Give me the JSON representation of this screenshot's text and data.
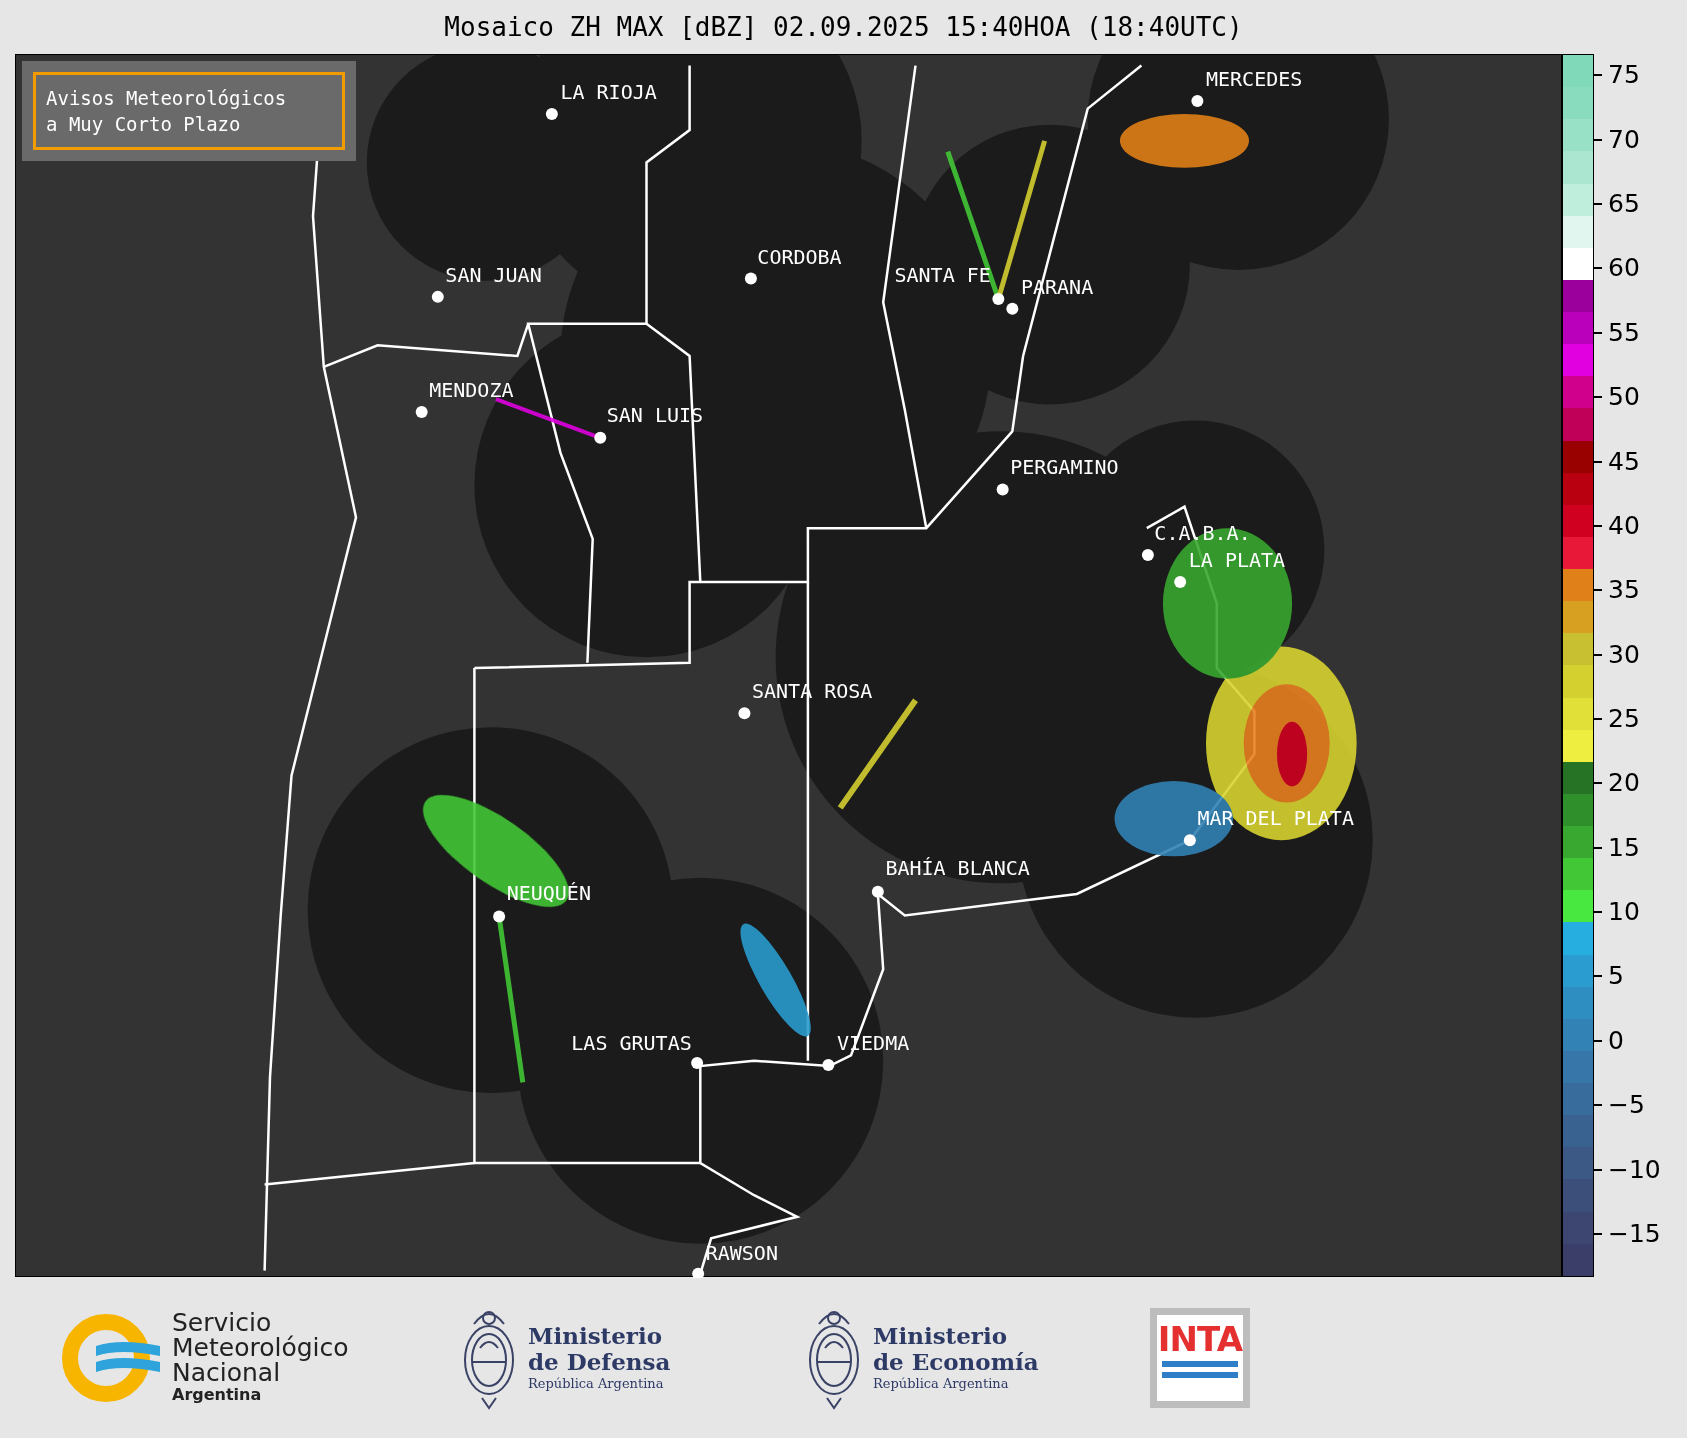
{
  "title": "Mosaico ZH MAX [dBZ] 02.09.2025 15:40HOA (18:40UTC)",
  "notice_box": {
    "lines": [
      "Avisos Meteorológicos",
      "a Muy Corto Plazo"
    ]
  },
  "cities": [
    {
      "name": "LA RIOJA"
    },
    {
      "name": "CORDOBA"
    },
    {
      "name": "SAN JUAN"
    },
    {
      "name": "SANTA FE"
    },
    {
      "name": "PARANA"
    },
    {
      "name": "MERCEDES"
    },
    {
      "name": "MENDOZA"
    },
    {
      "name": "SAN LUIS"
    },
    {
      "name": "PERGAMINO"
    },
    {
      "name": "C.A.B.A."
    },
    {
      "name": "LA PLATA"
    },
    {
      "name": "SANTA ROSA"
    },
    {
      "name": "MAR DEL PLATA"
    },
    {
      "name": "BAHÍA BLANCA"
    },
    {
      "name": "NEUQUÉN"
    },
    {
      "name": "LAS GRUTAS"
    },
    {
      "name": "VIEDMA"
    },
    {
      "name": "RAWSON"
    }
  ],
  "colorbar": {
    "ticks": [
      "75",
      "70",
      "65",
      "60",
      "55",
      "50",
      "45",
      "40",
      "35",
      "30",
      "25",
      "20",
      "15",
      "10",
      "5",
      "0",
      "−5",
      "−10",
      "−15"
    ],
    "segments": [
      {
        "color": "#80d9b9"
      },
      {
        "color": "#8adcbf"
      },
      {
        "color": "#98e0c6"
      },
      {
        "color": "#aae6d0"
      },
      {
        "color": "#c0eedc"
      },
      {
        "color": "#e0f6ee"
      },
      {
        "color": "#ffffff"
      },
      {
        "color": "#9c009c"
      },
      {
        "color": "#bb00bb"
      },
      {
        "color": "#e000e0"
      },
      {
        "color": "#d0008c"
      },
      {
        "color": "#c00058"
      },
      {
        "color": "#990000"
      },
      {
        "color": "#b80010"
      },
      {
        "color": "#d00020"
      },
      {
        "color": "#e81838"
      },
      {
        "color": "#e08018"
      },
      {
        "color": "#d8a020"
      },
      {
        "color": "#c8c030"
      },
      {
        "color": "#d4d030"
      },
      {
        "color": "#e0e038"
      },
      {
        "color": "#eeee40"
      },
      {
        "color": "#267326"
      },
      {
        "color": "#2f8f2a"
      },
      {
        "color": "#38a830"
      },
      {
        "color": "#42c836"
      },
      {
        "color": "#48e840"
      },
      {
        "color": "#26aee0"
      },
      {
        "color": "#2a9ccf"
      },
      {
        "color": "#2e8ec2"
      },
      {
        "color": "#3282b5"
      },
      {
        "color": "#3676a8"
      },
      {
        "color": "#386c9c"
      },
      {
        "color": "#3a6290"
      },
      {
        "color": "#3c5884"
      },
      {
        "color": "#3c4e7a"
      },
      {
        "color": "#3c4670"
      },
      {
        "color": "#3b3e68"
      }
    ]
  },
  "footer_logos": [
    {
      "kind": "smn",
      "lines": [
        "Servicio",
        "Meteorológico",
        "Nacional"
      ],
      "subtitle": "Argentina"
    },
    {
      "kind": "ministry",
      "lines": [
        "Ministerio",
        "de Defensa"
      ],
      "subtitle": "República Argentina"
    },
    {
      "kind": "ministry",
      "lines": [
        "Ministerio",
        "de Economía"
      ],
      "subtitle": "República Argentina"
    },
    {
      "kind": "inta",
      "text": "INTA"
    }
  ]
}
